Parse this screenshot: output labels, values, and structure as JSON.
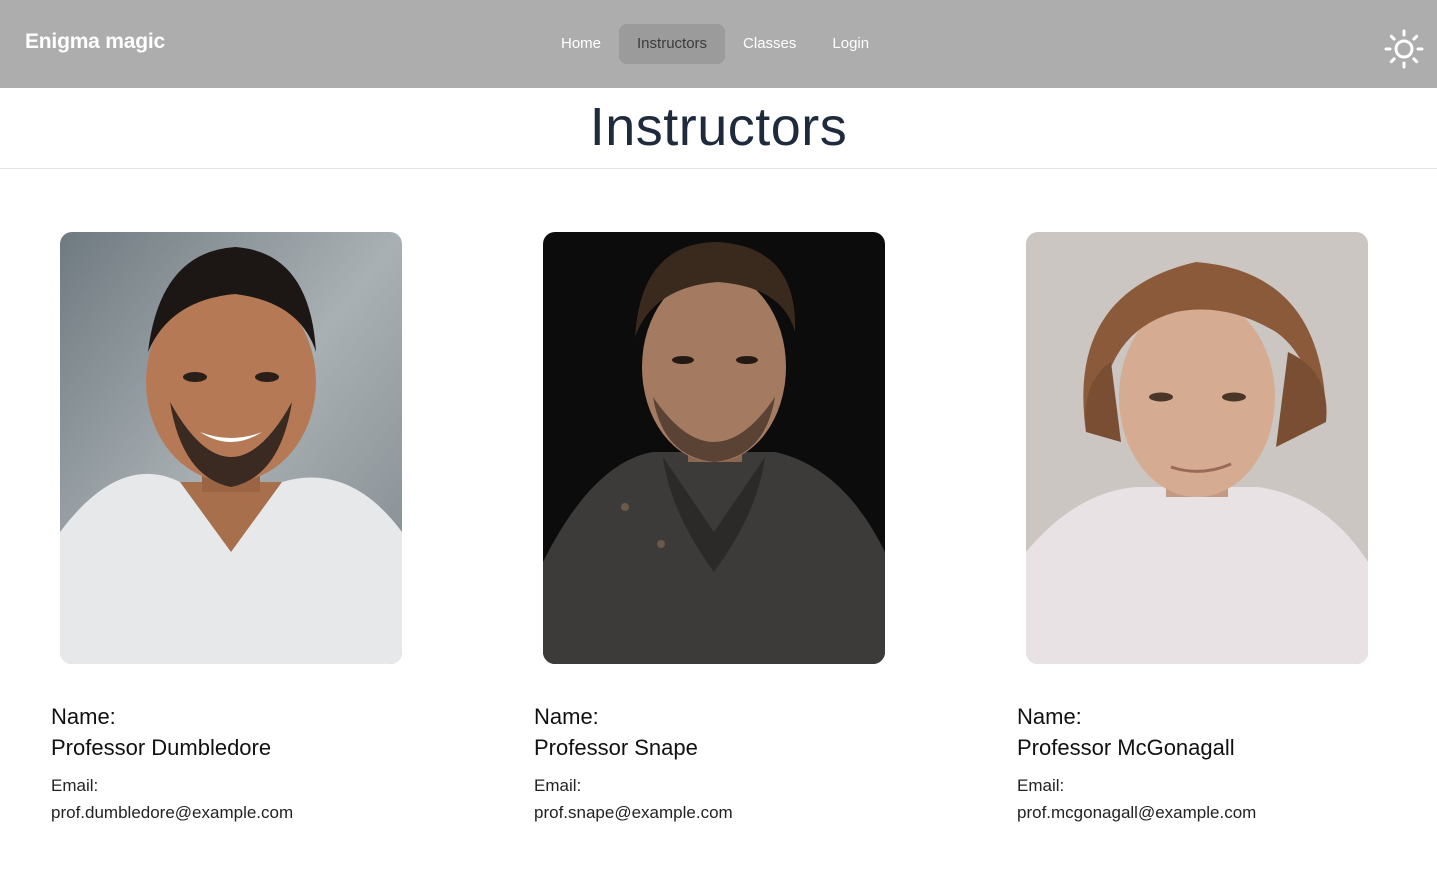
{
  "navbar": {
    "brand": "Enigma magic",
    "links": [
      {
        "label": "Home"
      },
      {
        "label": "Instructors",
        "active": true
      },
      {
        "label": "Classes"
      },
      {
        "label": "Login"
      }
    ],
    "theme_icon": "sun-icon"
  },
  "page": {
    "title": "Instructors"
  },
  "instructors": [
    {
      "name_label": "Name:",
      "name": "Professor Dumbledore",
      "email_label": "Email:",
      "email": "prof.dumbledore@example.com"
    },
    {
      "name_label": "Name:",
      "name": "Professor Snape",
      "email_label": "Email:",
      "email": "prof.snape@example.com"
    },
    {
      "name_label": "Name:",
      "name": "Professor McGonagall",
      "email_label": "Email:",
      "email": "prof.mcgonagall@example.com"
    }
  ],
  "colors": {
    "navbar_bg": "#adadad",
    "active_link_bg": "#9b9b9b",
    "title": "#1f2a3d"
  }
}
